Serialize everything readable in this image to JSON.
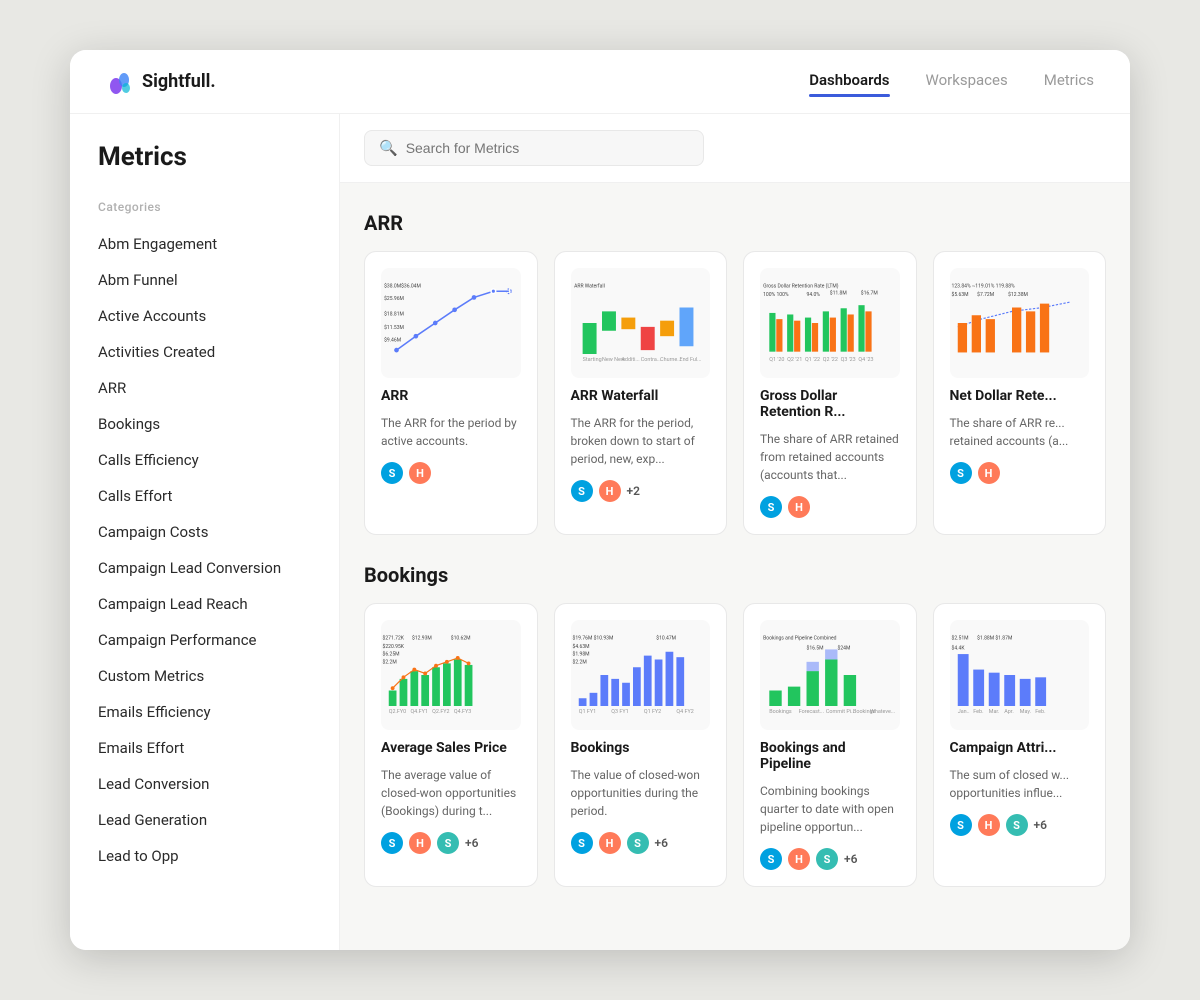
{
  "header": {
    "logo_text": "Sightfull.",
    "nav_items": [
      {
        "label": "Dashboards",
        "active": true
      },
      {
        "label": "Workspaces",
        "active": false
      },
      {
        "label": "Metrics",
        "active": false
      }
    ]
  },
  "sidebar": {
    "title": "Metrics",
    "category_label": "Categories",
    "items": [
      "Abm Engagement",
      "Abm Funnel",
      "Active Accounts",
      "Activities Created",
      "ARR",
      "Bookings",
      "Calls Efficiency",
      "Calls Effort",
      "Campaign Costs",
      "Campaign Lead Conversion",
      "Campaign Lead Reach",
      "Campaign Performance",
      "Custom Metrics",
      "Emails Efficiency",
      "Emails Effort",
      "Lead Conversion",
      "Lead Generation",
      "Lead to Opp"
    ]
  },
  "search": {
    "placeholder": "Search for Metrics"
  },
  "sections": [
    {
      "title": "ARR",
      "cards": [
        {
          "name": "ARR",
          "desc": "The ARR for the period by active accounts.",
          "chart_type": "line",
          "icons": [
            "sf",
            "hs"
          ],
          "plus": ""
        },
        {
          "name": "ARR Waterfall",
          "desc": "The ARR for the period, broken down to start of period, new, exp...",
          "chart_type": "waterfall",
          "icons": [
            "sf",
            "hs"
          ],
          "plus": "+2"
        },
        {
          "name": "Gross Dollar Retention R...",
          "desc": "The share of ARR retained from retained accounts (accounts that...",
          "chart_type": "bar_multi",
          "icons": [
            "sf",
            "hs"
          ],
          "plus": ""
        },
        {
          "name": "Net Dollar Rete...",
          "desc": "The share of ARR re... retained accounts (a...",
          "chart_type": "bar_orange",
          "icons": [
            "sf",
            "hs"
          ],
          "plus": ""
        }
      ]
    },
    {
      "title": "Bookings",
      "cards": [
        {
          "name": "Average Sales Price",
          "desc": "The average value of closed-won opportunities (Bookings) during t...",
          "chart_type": "bar_blue_line",
          "icons": [
            "sf",
            "hs",
            "s"
          ],
          "plus": "+6"
        },
        {
          "name": "Bookings",
          "desc": "The value of closed-won opportunities during the period.",
          "chart_type": "bar_blue2",
          "icons": [
            "sf",
            "hs",
            "s"
          ],
          "plus": "+6"
        },
        {
          "name": "Bookings and Pipeline",
          "desc": "Combining bookings quarter to date with open pipeline opportun...",
          "chart_type": "bar_green_blue",
          "icons": [
            "sf",
            "hs",
            "s"
          ],
          "plus": "+6"
        },
        {
          "name": "Campaign Attri...",
          "desc": "The sum of closed w... opportunities influe...",
          "chart_type": "bar_mixed",
          "icons": [
            "sf",
            "hs",
            "s"
          ],
          "plus": "+6"
        }
      ]
    }
  ]
}
